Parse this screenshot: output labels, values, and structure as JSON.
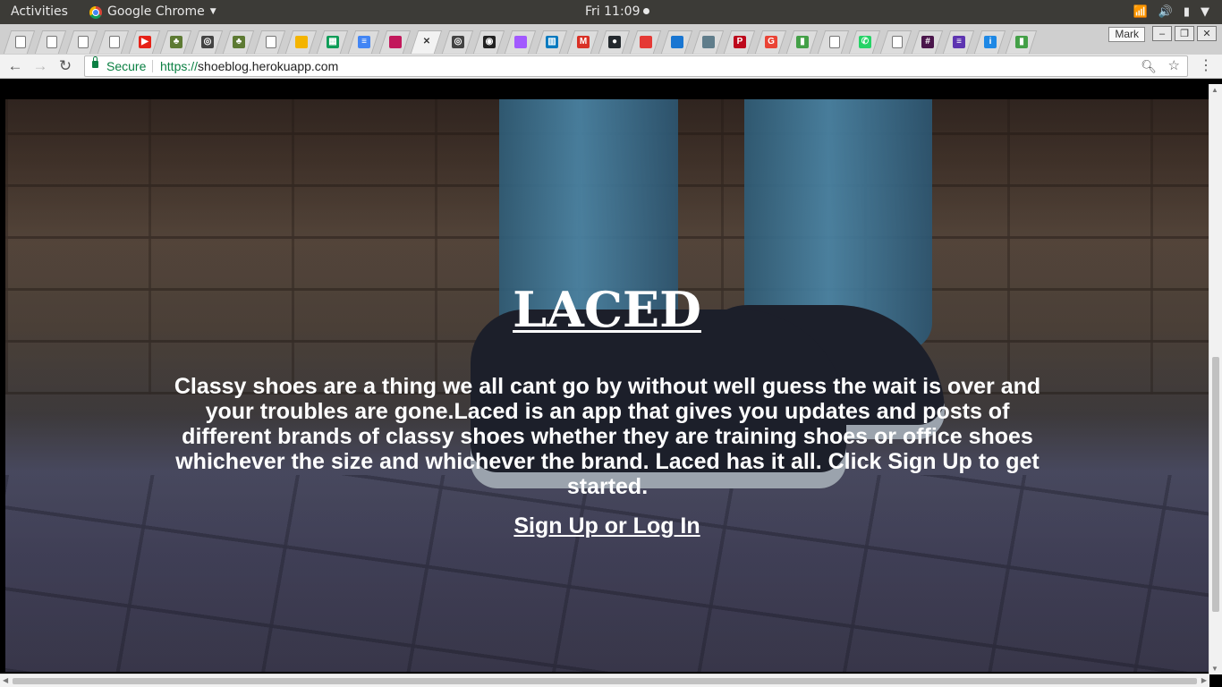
{
  "topbar": {
    "activities": "Activities",
    "app_name": "Google Chrome",
    "clock": "Fri 11:09",
    "icons": [
      "wifi-icon",
      "volume-icon",
      "battery-icon",
      "power-menu-icon"
    ]
  },
  "browser": {
    "profile_name": "Mark",
    "tab_icons": [
      "document-icon",
      "document-icon",
      "document-icon",
      "document-icon",
      "youtube-icon",
      "tree-icon",
      "instagram-icon",
      "tree-icon",
      "document-icon",
      "google-drive-icon",
      "google-sheets-icon",
      "google-docs-icon",
      "grid-icon",
      "close-icon",
      "instagram-icon",
      "camera-icon",
      "figma-icon",
      "trello-icon",
      "gmail-icon",
      "github-icon",
      "tool-icon",
      "bird-icon",
      "image-icon",
      "pinterest-icon",
      "google-icon",
      "battery-green-icon",
      "document-icon",
      "whatsapp-icon",
      "document-icon",
      "slack-icon",
      "list-icon",
      "info-icon",
      "battery-green-icon"
    ],
    "active_tab_index": 13,
    "secure_label": "Secure",
    "url_scheme": "https://",
    "url_host": "shoeblog.herokuapp.com",
    "window_buttons": [
      "–",
      "❐",
      "✕"
    ]
  },
  "page": {
    "title": "LACED",
    "description": "Classy shoes are a thing we all cant go by without well guess the wait is over and your troubles are gone.Laced is an app that gives you updates and posts of different brands of classy shoes whether they are training shoes or office shoes whichever the size and whichever the brand. Laced has it all. Click Sign Up to get started.",
    "cta_label": "Sign Up or Log In"
  }
}
